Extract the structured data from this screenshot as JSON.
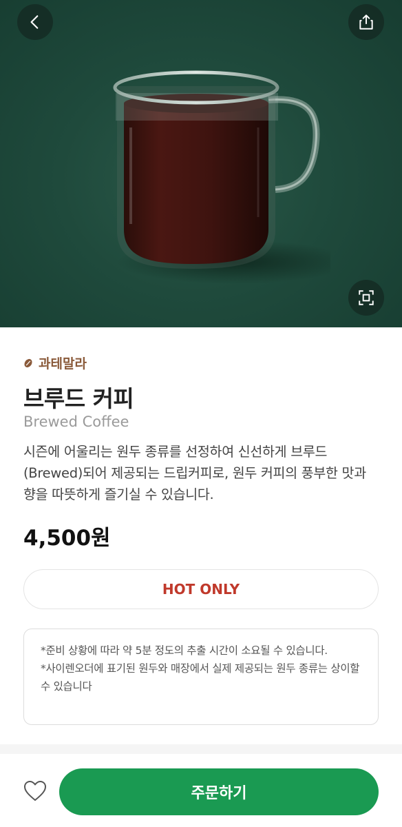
{
  "hero": {
    "back_icon": "chevron-left-icon",
    "share_icon": "share-icon",
    "zoom_icon": "expand-icon",
    "image_subject": "brewed coffee in glass mug",
    "background_color": "#1f4a3c"
  },
  "product": {
    "origin": "과테말라",
    "origin_color": "#8a5a3a",
    "name_ko": "브루드 커피",
    "name_en": "Brewed Coffee",
    "description": "시즌에 어울리는 원두 종류를 선정하여 신선하게 브루드(Brewed)되어 제공되는 드립커피로, 원두 커피의 풍부한 맛과 향을 따뜻하게 즐기실 수 있습니다.",
    "price": "4,500원",
    "temperature_label": "HOT ONLY",
    "temperature_color": "#c0392b"
  },
  "notice": {
    "line1": "*준비 상황에 따라 약 5분 정도의 추출 시간이 소요될 수 있습니다.",
    "line2": "*사이렌오더에 표기된 원두와 매장에서 실제 제공되는 원두 종류는 상이할 수 있습니다"
  },
  "footer": {
    "favorite_icon": "heart-outline-icon",
    "order_label": "주문하기",
    "order_color": "#1a9a52"
  }
}
